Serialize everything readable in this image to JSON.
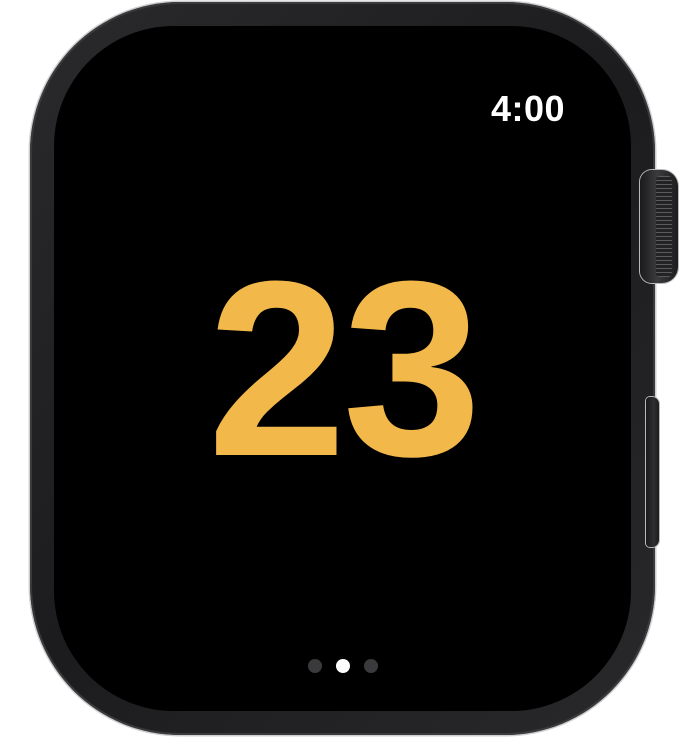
{
  "status": {
    "time": "4:00"
  },
  "main": {
    "count": "23",
    "count_color": "#F2B84A"
  },
  "pager": {
    "page_count": 3,
    "active_index": 1
  }
}
